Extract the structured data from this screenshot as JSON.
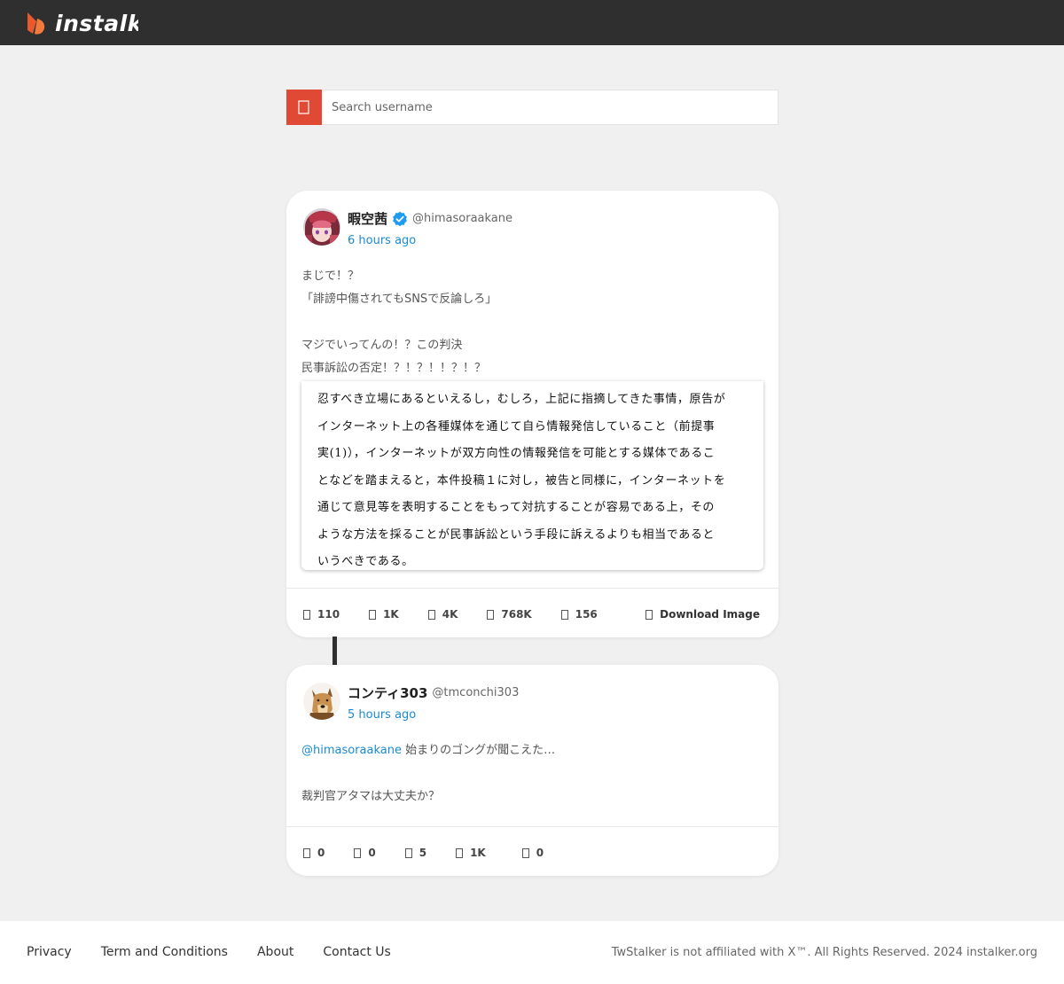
{
  "header": {
    "logo_text": "instalk"
  },
  "search": {
    "placeholder": "Search username",
    "icon": "search-icon"
  },
  "posts": [
    {
      "name": "暇空茜",
      "verified": true,
      "handle": "@himasoraakane",
      "time": "6 hours ago",
      "text_lines": [
        "まじで！？",
        "「誹謗中傷されてもSNSで反論しろ」",
        "",
        "マジでいってんの！？この判決",
        "民事訴訟の否定！？！？！！？！？"
      ],
      "image_text_lines": [
        "忍すべき立場にあるといえるし，むしろ，上記に指摘してきた事情，原告が",
        "インターネット上の各種媒体を通じて自ら情報発信していること（前提事",
        "実(1)），インターネットが双方向性の情報発信を可能とする媒体であるこ",
        "となどを踏まえると，本件投稿１に対し，被告と同様に，インターネットを",
        "通じて意見等を表明することをもって対抗することが容易である上，その",
        "ような方法を採ることが民事訴訟という手段に訴えるよりも相当であると",
        "いうべきである。"
      ],
      "stats": [
        "110",
        "1K",
        "4K",
        "768K",
        "156"
      ],
      "download_label": "Download Image"
    },
    {
      "name": "コンティ303",
      "verified": false,
      "handle": "@tmconchi303",
      "time": "5 hours ago",
      "mention": "@himasoraakane",
      "text_first": " 始まりのゴングが聞こえた…",
      "text_lines": [
        "",
        "裁判官アタマは大丈夫か？"
      ],
      "stats": [
        "0",
        "0",
        "5",
        "1K",
        "0"
      ]
    }
  ],
  "footer": {
    "links": [
      "Privacy",
      "Term and Conditions",
      "About",
      "Contact Us"
    ],
    "copyright": "TwStalker is not affiliated with X™. All Rights Reserved. 2024 instalker.org"
  },
  "colors": {
    "accent": "#e04a35",
    "link": "#1a8bd0",
    "topbar": "#2f2f2f"
  }
}
